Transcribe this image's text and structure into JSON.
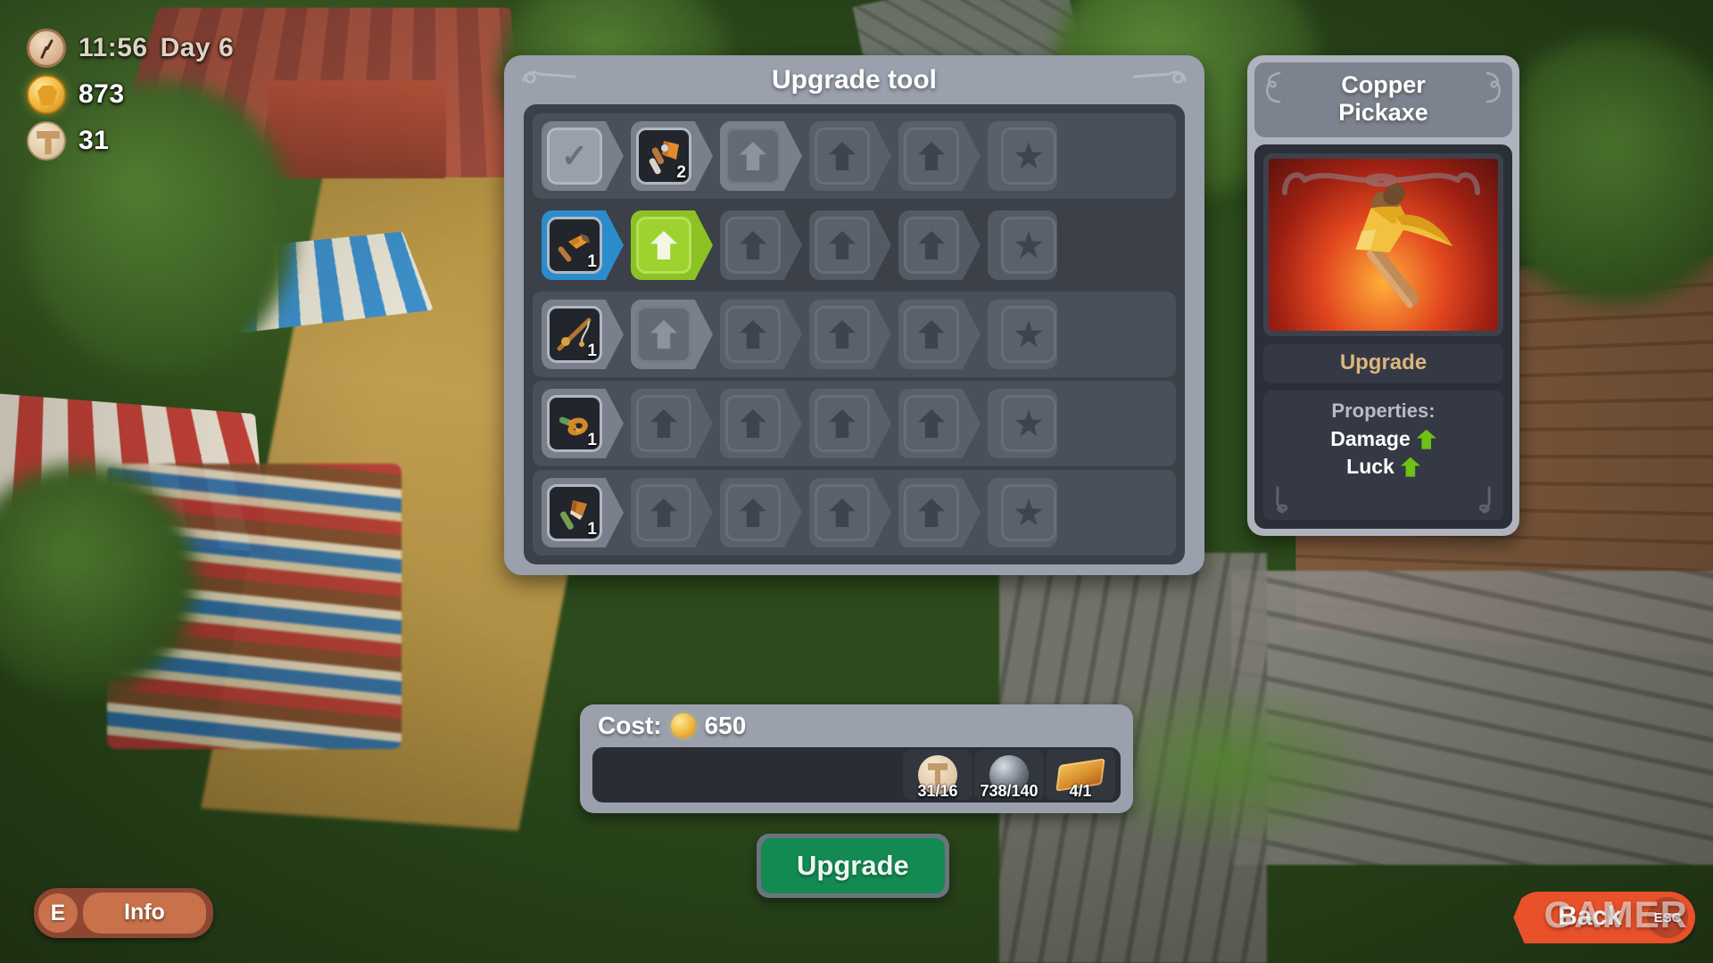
{
  "hud": {
    "clock_icon": "clock-icon",
    "time": "11:56",
    "day": "Day 6",
    "coin_icon": "coin-icon",
    "coins": "873",
    "material_icon": "hammer-token-icon",
    "materials": "31"
  },
  "panel": {
    "title": "Upgrade tool",
    "rows": [
      {
        "tool": "stone-axe-icon",
        "tool_level": "2",
        "selected": false,
        "active": true,
        "cells": [
          {
            "type": "check",
            "state": "done"
          },
          {
            "type": "tool",
            "state": "current"
          },
          {
            "type": "arrow",
            "state": "available"
          },
          {
            "type": "arrow",
            "state": "locked"
          },
          {
            "type": "arrow",
            "state": "locked"
          },
          {
            "type": "star",
            "state": "locked"
          }
        ]
      },
      {
        "tool": "copper-pickaxe-icon",
        "tool_level": "1",
        "selected": true,
        "active": true,
        "cells": [
          {
            "type": "tool",
            "state": "selected"
          },
          {
            "type": "arrow",
            "state": "highlighted"
          },
          {
            "type": "arrow",
            "state": "locked"
          },
          {
            "type": "arrow",
            "state": "locked"
          },
          {
            "type": "arrow",
            "state": "locked"
          },
          {
            "type": "star",
            "state": "locked"
          }
        ]
      },
      {
        "tool": "fishing-rod-icon",
        "tool_level": "1",
        "selected": false,
        "active": true,
        "cells": [
          {
            "type": "tool",
            "state": "current"
          },
          {
            "type": "arrow",
            "state": "available"
          },
          {
            "type": "arrow",
            "state": "locked"
          },
          {
            "type": "arrow",
            "state": "locked"
          },
          {
            "type": "arrow",
            "state": "locked"
          },
          {
            "type": "star",
            "state": "locked"
          }
        ]
      },
      {
        "tool": "whip-icon",
        "tool_level": "1",
        "selected": false,
        "active": false,
        "cells": [
          {
            "type": "tool",
            "state": "current"
          },
          {
            "type": "arrow",
            "state": "locked"
          },
          {
            "type": "arrow",
            "state": "locked"
          },
          {
            "type": "arrow",
            "state": "locked"
          },
          {
            "type": "arrow",
            "state": "locked"
          },
          {
            "type": "star",
            "state": "locked"
          }
        ]
      },
      {
        "tool": "wooden-axe-icon",
        "tool_level": "1",
        "selected": false,
        "active": false,
        "cells": [
          {
            "type": "tool",
            "state": "current"
          },
          {
            "type": "arrow",
            "state": "locked"
          },
          {
            "type": "arrow",
            "state": "locked"
          },
          {
            "type": "arrow",
            "state": "locked"
          },
          {
            "type": "arrow",
            "state": "locked"
          },
          {
            "type": "star",
            "state": "locked"
          }
        ]
      }
    ]
  },
  "cost": {
    "label": "Cost:",
    "coin_icon": "coin-icon",
    "amount": "650",
    "materials": [
      {
        "icon": "wood-token-icon",
        "count": "31/16"
      },
      {
        "icon": "ore-token-icon",
        "count": "738/140"
      },
      {
        "icon": "copper-ingot-icon",
        "count": "4/1"
      }
    ]
  },
  "cta": {
    "label": "Upgrade"
  },
  "detail": {
    "title_line1": "Copper",
    "title_line2": "Pickaxe",
    "art_icon": "copper-pickaxe-art",
    "section_label": "Upgrade",
    "properties_header": "Properties:",
    "properties": [
      {
        "name": "Damage",
        "change": "up"
      },
      {
        "name": "Luck",
        "change": "up"
      }
    ]
  },
  "info_button": {
    "key": "E",
    "label": "Info"
  },
  "back_button": {
    "label": "Back",
    "key": "ESC"
  },
  "watermark": {
    "text": "GAMER"
  },
  "colors": {
    "panel_bg": "#9aa0ac",
    "grid_bg": "#3b4049",
    "selected_blue": "#2b8ccc",
    "available_green": "#8cc224",
    "cta_green": "#138a52",
    "accent_tan": "#dcb67c",
    "back_red": "#e8512a",
    "info_orange": "#c8714b"
  }
}
